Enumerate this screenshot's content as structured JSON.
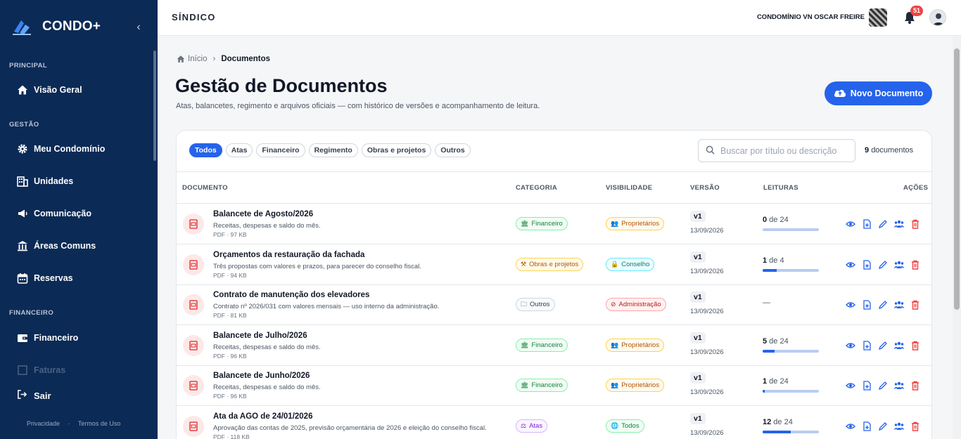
{
  "app": {
    "name": "CONDO+",
    "role_title": "SÍNDICO",
    "condominium": "CONDOMÍNIO VN OSCAR FREIRE",
    "notification_count": "51"
  },
  "sidebar": {
    "sections": [
      {
        "label": "PRINCIPAL"
      },
      {
        "label": "GESTÃO"
      },
      {
        "label": "FINANCEIRO"
      }
    ],
    "items": [
      {
        "label": "Visão Geral",
        "icon": "home-icon"
      },
      {
        "label": "Meu Condomínio",
        "icon": "gear-icon"
      },
      {
        "label": "Unidades",
        "icon": "building-icon"
      },
      {
        "label": "Comunicação",
        "icon": "megaphone-icon"
      },
      {
        "label": "Áreas Comuns",
        "icon": "columns-icon"
      },
      {
        "label": "Reservas",
        "icon": "calendar-icon"
      },
      {
        "label": "Financeiro",
        "icon": "wallet-icon"
      },
      {
        "label": "Faturas",
        "icon": "invoice-icon"
      }
    ],
    "logout": "Sair",
    "footer": {
      "privacy": "Privacidade",
      "terms": "Termos de Uso"
    }
  },
  "breadcrumb": {
    "home": "Início",
    "current": "Documentos"
  },
  "page": {
    "title": "Gestão de Documentos",
    "subtitle": "Atas, balancetes, regimento e arquivos oficiais — com histórico de versões e acompanhamento de leitura.",
    "new_button": "Novo Documento"
  },
  "filters": [
    {
      "label": "Todos",
      "active": true
    },
    {
      "label": "Atas"
    },
    {
      "label": "Financeiro"
    },
    {
      "label": "Regimento"
    },
    {
      "label": "Obras e projetos"
    },
    {
      "label": "Outros"
    }
  ],
  "search": {
    "placeholder": "Buscar por título ou descrição"
  },
  "count": {
    "number": "9",
    "label": "documentos"
  },
  "table": {
    "headers": {
      "document": "DOCUMENTO",
      "category": "CATEGORIA",
      "visibility": "VISIBILIDADE",
      "version": "VERSÃO",
      "reads": "LEITURAS",
      "actions": "AÇÕES"
    },
    "rows": [
      {
        "title": "Balancete de Agosto/2026",
        "desc": "Receitas, despesas e saldo do mês.",
        "meta": "PDF · 97 KB",
        "category": "Financeiro",
        "cat_style": "green",
        "cat_icon": "🏛",
        "visibility": "Proprietários",
        "vis_style": "amber",
        "vis_icon": "👥",
        "version": "v1",
        "date": "13/09/2026",
        "read_n": "0",
        "read_sep": " de ",
        "read_total": "24",
        "read_fraction": 0.0
      },
      {
        "title": "Orçamentos da restauração da fachada",
        "desc": "Três propostas com valores e prazos, para parecer do conselho fiscal.",
        "meta": "PDF · 94 KB",
        "category": "Obras e projetos",
        "cat_style": "amber",
        "cat_icon": "⚒",
        "visibility": "Conselho",
        "vis_style": "teal",
        "vis_icon": "🔒",
        "version": "v1",
        "date": "13/09/2026",
        "read_n": "1",
        "read_sep": " de ",
        "read_total": "4",
        "read_fraction": 0.25
      },
      {
        "title": "Contrato de manutenção dos elevadores",
        "desc": "Contrato nº 2026/031 com valores mensais — uso interno da administração.",
        "meta": "PDF · 81 KB",
        "category": "Outros",
        "cat_style": "gray",
        "cat_icon": "🗀",
        "visibility": "Administração",
        "vis_style": "red",
        "vis_icon": "⊘",
        "version": "v1",
        "date": "13/09/2026",
        "read_dash": "—"
      },
      {
        "title": "Balancete de Julho/2026",
        "desc": "Receitas, despesas e saldo do mês.",
        "meta": "PDF · 96 KB",
        "category": "Financeiro",
        "cat_style": "green",
        "cat_icon": "🏛",
        "visibility": "Proprietários",
        "vis_style": "amber",
        "vis_icon": "👥",
        "version": "v1",
        "date": "13/09/2026",
        "read_n": "5",
        "read_sep": " de ",
        "read_total": "24",
        "read_fraction": 0.21
      },
      {
        "title": "Balancete de Junho/2026",
        "desc": "Receitas, despesas e saldo do mês.",
        "meta": "PDF · 96 KB",
        "category": "Financeiro",
        "cat_style": "green",
        "cat_icon": "🏛",
        "visibility": "Proprietários",
        "vis_style": "amber",
        "vis_icon": "👥",
        "version": "v1",
        "date": "13/09/2026",
        "read_n": "1",
        "read_sep": " de ",
        "read_total": "24",
        "read_fraction": 0.04
      },
      {
        "title": "Ata da AGO de 24/01/2026",
        "desc": "Aprovação das contas de 2025, previsão orçamentária de 2026 e eleição do conselho fiscal.",
        "meta": "PDF · 118 KB",
        "category": "Atas",
        "cat_style": "purple",
        "cat_icon": "⚖",
        "visibility": "Todos",
        "vis_style": "green",
        "vis_icon": "🌐",
        "version": "v1",
        "date": "13/09/2026",
        "read_n": "12",
        "read_sep": " de ",
        "read_total": "24",
        "read_fraction": 0.5
      }
    ]
  },
  "colors": {
    "sidebar": "#0b2a55",
    "accent": "#2563eb",
    "danger": "#ef4444"
  }
}
